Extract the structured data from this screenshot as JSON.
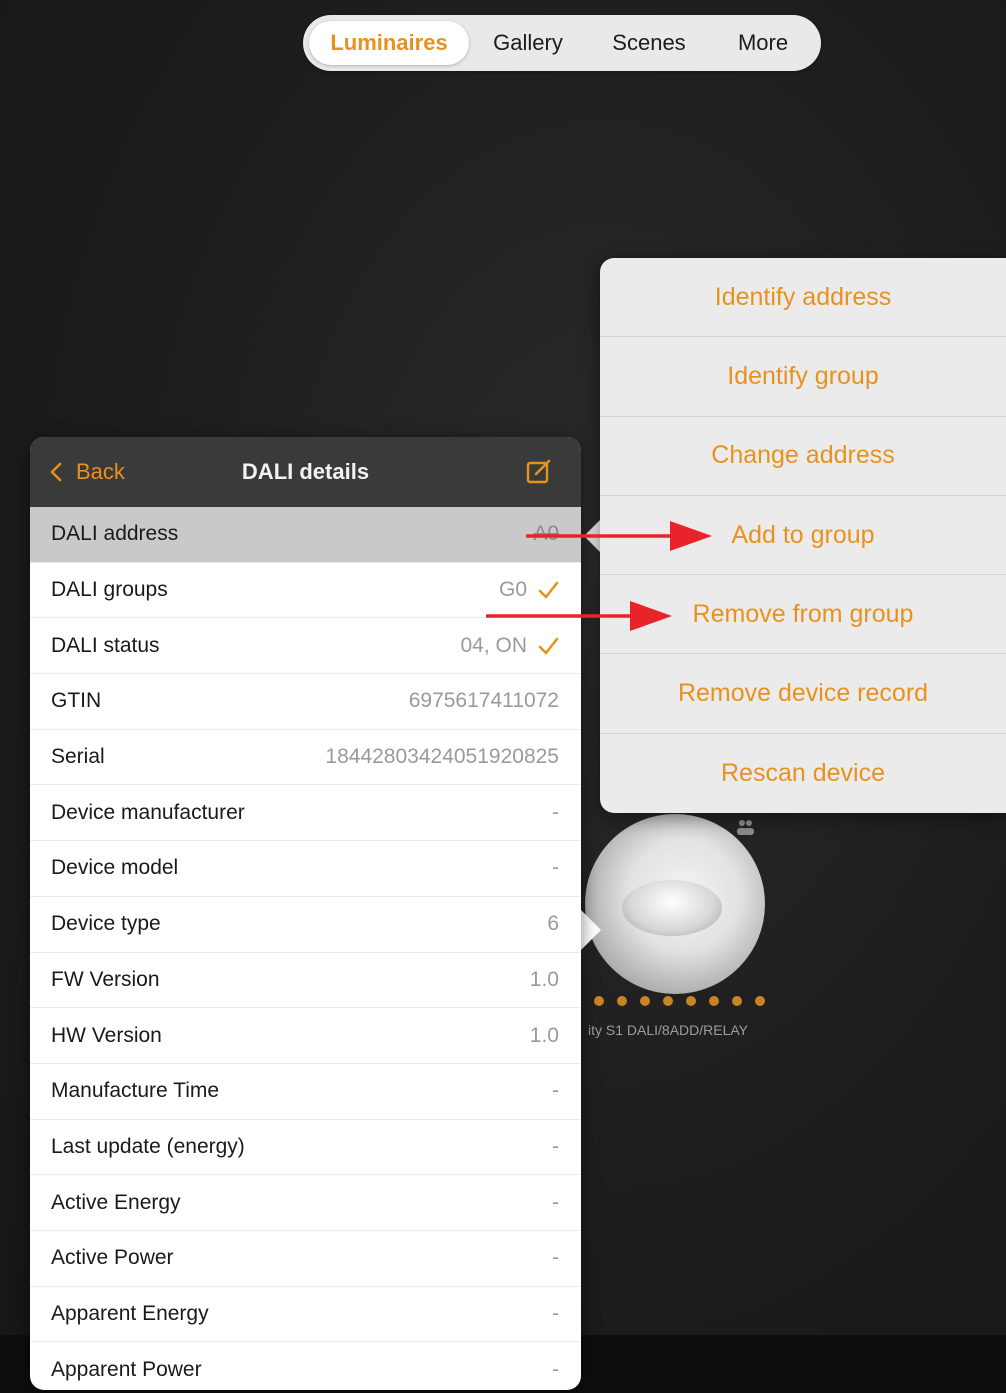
{
  "tabs": [
    {
      "label": "Luminaires",
      "active": true
    },
    {
      "label": "Gallery",
      "active": false
    },
    {
      "label": "Scenes",
      "active": false
    },
    {
      "label": "More",
      "active": false
    }
  ],
  "menu": {
    "items": [
      "Identify address",
      "Identify group",
      "Change address",
      "Add to group",
      "Remove from group",
      "Remove device record",
      "Rescan device"
    ]
  },
  "panel": {
    "back_label": "Back",
    "title": "DALI details",
    "rows": [
      {
        "label": "DALI address",
        "value": "A0",
        "check": false
      },
      {
        "label": "DALI groups",
        "value": "G0",
        "check": true
      },
      {
        "label": "DALI status",
        "value": "04, ON",
        "check": true
      },
      {
        "label": "GTIN",
        "value": "6975617411072",
        "check": false
      },
      {
        "label": "Serial",
        "value": "18442803424051920825",
        "check": false
      },
      {
        "label": "Device manufacturer",
        "value": "-",
        "check": false
      },
      {
        "label": "Device model",
        "value": "-",
        "check": false
      },
      {
        "label": "Device type",
        "value": "6",
        "check": false
      },
      {
        "label": "FW Version",
        "value": "1.0",
        "check": false
      },
      {
        "label": "HW Version",
        "value": "1.0",
        "check": false
      },
      {
        "label": "Manufacture Time",
        "value": "-",
        "check": false
      },
      {
        "label": "Last update (energy)",
        "value": "-",
        "check": false
      },
      {
        "label": "Active Energy",
        "value": "-",
        "check": false
      },
      {
        "label": "Active Power",
        "value": "-",
        "check": false
      },
      {
        "label": "Apparent Energy",
        "value": "-",
        "check": false
      },
      {
        "label": "Apparent Power",
        "value": "-",
        "check": false
      }
    ]
  },
  "background": {
    "device_label": "ity S1 DALI/8ADD/RELAY"
  },
  "colors": {
    "accent": "#e8921e",
    "arrow": "#e8232a",
    "nav_bar": "#3a3a3a",
    "menu_bg": "#ebebeb"
  },
  "icons": {
    "back": "chevron-left-icon",
    "edit": "edit-square-icon",
    "check": "checkmark-icon",
    "people": "people-icon"
  }
}
